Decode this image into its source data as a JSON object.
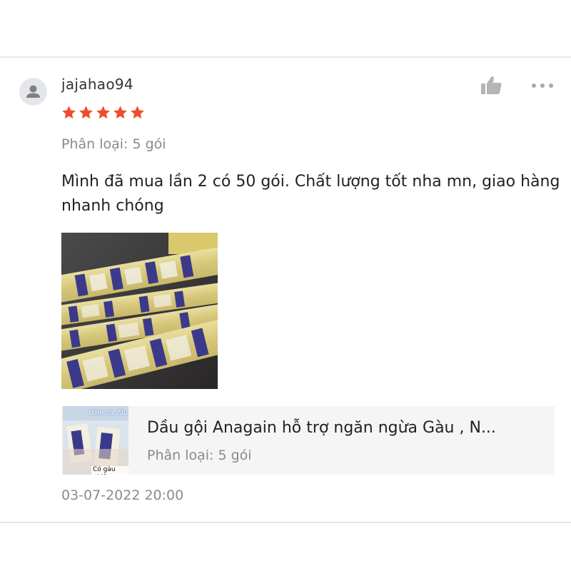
{
  "review": {
    "username": "jajahao94",
    "rating": 5,
    "star_color": "#ee4d2d",
    "variation": "Phân loại: 5 gói",
    "text": "Mình đã mua lần 2 có 50 gói. Chất lượng tốt nha mn, giao hàng nhanh chóng",
    "timestamp": "03-07-2022 20:00"
  },
  "product": {
    "name": "Dầu gội Anagain hỗ trợ ngăn ngừa Gàu , N...",
    "variation": "Phân loại: 5 gói",
    "thumbnail_caption_top": "Nấm da đầu",
    "thumbnail_caption_bottom": "Có gàu nhiều"
  },
  "icons": {
    "avatar": "user-avatar-icon",
    "like": "thumbs-up-icon",
    "more": "more-options-icon",
    "star": "star-icon"
  },
  "colors": {
    "text_primary": "#222222",
    "text_secondary": "#8a8a8a",
    "card_background": "#f5f5f5",
    "icon_gray": "#b5b5b5"
  }
}
